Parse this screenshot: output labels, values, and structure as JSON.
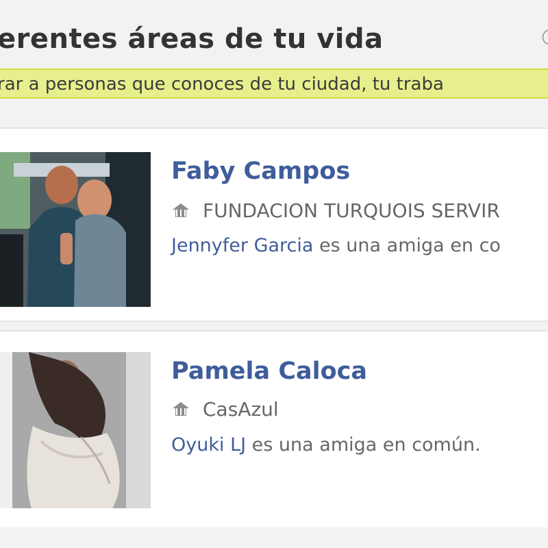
{
  "header": {
    "title": "erentes áreas de tu vida",
    "subtitle": "rar a personas que conoces de tu ciudad, tu traba"
  },
  "colors": {
    "accent_link": "#3f5d9b",
    "highlight": "#e6ef8b",
    "highlight_border": "#d1de3b",
    "secondary_text": "#666666"
  },
  "suggestions": [
    {
      "name": "Faby Campos",
      "organization": "FUNDACION TURQUOIS SERVIR",
      "mutual_friend": "Jennyfer Garcia",
      "mutual_text": " es una amiga en co",
      "icon": "workplace-icon"
    },
    {
      "name": "Pamela Caloca",
      "organization": "CasAzul",
      "mutual_friend": "Oyuki LJ",
      "mutual_text": " es una amiga en común.",
      "icon": "workplace-icon"
    }
  ]
}
